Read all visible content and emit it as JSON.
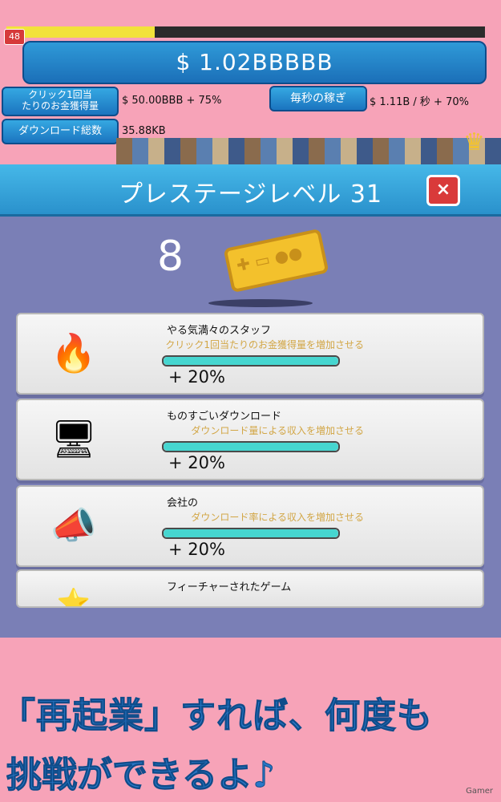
{
  "hud": {
    "level": "48",
    "xp_progress": 0.31,
    "money": "$ 1.02BBBBB",
    "click_label": "クリック1回当\nたりのお金獲得量",
    "click_value": "$ 50.00BBB + 75%",
    "per_sec_label": "毎秒の稼ぎ",
    "per_sec_value": "$ 1.11B / 秒 + 70%",
    "download_label": "ダウンロード総数",
    "download_value": "35.88KB"
  },
  "prestige": {
    "title": "プレステージレベル 31",
    "close_icon": "×",
    "points": "8",
    "upgrades": [
      {
        "name": "やる気満々のスタッフ",
        "desc": "クリック1回当たりのお金獲得量を増加させる",
        "bonus": "+ 20%",
        "progress": 1.0,
        "icon": "🔥"
      },
      {
        "name": "ものすごいダウンロード",
        "desc": "ダウンロード量による収入を増加させる",
        "bonus": "+ 20%",
        "progress": 1.0,
        "icon": "🖥"
      },
      {
        "name": "会社の",
        "desc": "ダウンロード率による収入を増加させる",
        "bonus": "+ 20%",
        "progress": 1.0,
        "icon": "📣"
      },
      {
        "name": "フィーチャーされたゲーム",
        "desc": "",
        "bonus": "",
        "progress": 0,
        "icon": "⭐"
      }
    ]
  },
  "caption": {
    "line1": "「再起業」すれば、何度も",
    "line2": "挑戦ができるよ♪",
    "watermark": "Gamer"
  },
  "colors": {
    "accent": "#2a91cc",
    "bg": "#f7a3b8",
    "panel": "#7a7fb6"
  }
}
